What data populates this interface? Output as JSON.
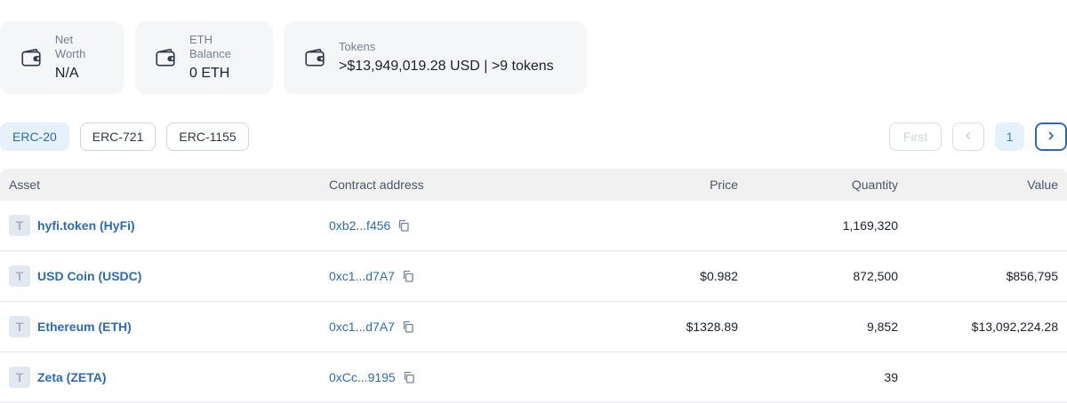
{
  "summary": {
    "net_worth": {
      "label": "Net Worth",
      "value": "N/A",
      "icon": "wallet-icon"
    },
    "eth_balance": {
      "label": "ETH Balance",
      "value": "0 ETH",
      "icon": "wallet-icon"
    },
    "tokens": {
      "label": "Tokens",
      "value": ">$13,949,019.28 USD | >9 tokens",
      "icon": "wallet-icon"
    }
  },
  "tabs": [
    {
      "label": "ERC-20",
      "active": true
    },
    {
      "label": "ERC-721",
      "active": false
    },
    {
      "label": "ERC-1155",
      "active": false
    }
  ],
  "pagination": {
    "first_label": "First",
    "current_page": "1",
    "prev_icon": "chevron-left-icon",
    "next_icon": "chevron-right-icon"
  },
  "table": {
    "headers": {
      "asset": "Asset",
      "contract": "Contract address",
      "price": "Price",
      "quantity": "Quantity",
      "value": "Value"
    },
    "rows": [
      {
        "badge": "T",
        "asset": "hyfi.token (HyFi)",
        "contract": "0xb2...f456",
        "price": "",
        "quantity": "1,169,320",
        "value": ""
      },
      {
        "badge": "T",
        "asset": "USD Coin (USDC)",
        "contract": "0xc1...d7A7",
        "price": "$0.982",
        "quantity": "872,500",
        "value": "$856,795"
      },
      {
        "badge": "T",
        "asset": "Ethereum (ETH)",
        "contract": "0xc1...d7A7",
        "price": "$1328.89",
        "quantity": "9,852",
        "value": "$13,092,224.28"
      },
      {
        "badge": "T",
        "asset": "Zeta (ZETA)",
        "contract": "0xCc...9195",
        "price": "",
        "quantity": "39",
        "value": ""
      }
    ]
  },
  "colors": {
    "accent": "#2b6cb0",
    "active_tab_bg": "#e6f2fb",
    "card_bg": "#f5f6f7",
    "header_bg": "#f1f1f1"
  }
}
